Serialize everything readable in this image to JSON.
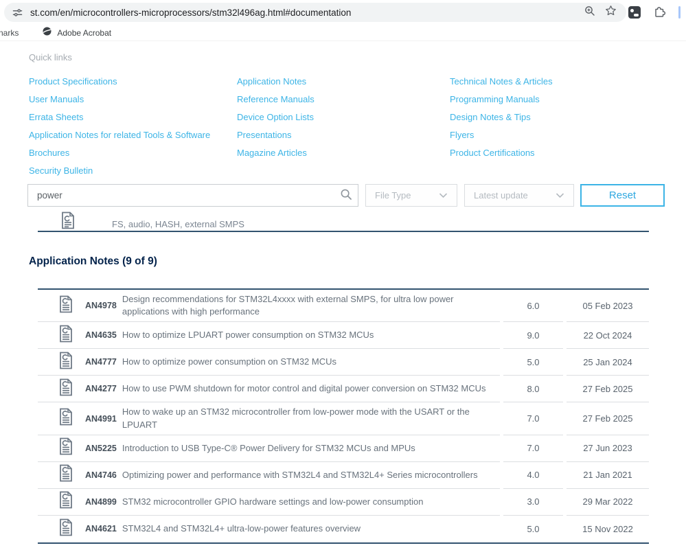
{
  "browser": {
    "url": "st.com/en/microcontrollers-microprocessors/stm32l496ag.html#documentation",
    "bookmarks_fragment": "narks",
    "bookmark_adobe_label": "Adobe Acrobat"
  },
  "quick_links": {
    "title": "Quick links",
    "columns": [
      [
        "Product Specifications",
        "User Manuals",
        "Errata Sheets",
        "Application Notes for related Tools & Software",
        "Brochures",
        "Security Bulletin"
      ],
      [
        "Application Notes",
        "Reference Manuals",
        "Device Option Lists",
        "Presentations",
        "Magazine Articles"
      ],
      [
        "Technical Notes & Articles",
        "Programming Manuals",
        "Design Notes & Tips",
        "Flyers",
        "Product Certifications"
      ]
    ]
  },
  "filters": {
    "search_value": "power",
    "file_type_label": "File Type",
    "latest_update_label": "Latest update",
    "reset_label": "Reset"
  },
  "partial_row": {
    "text": "FS, audio, HASH, external SMPS"
  },
  "section": {
    "heading": "Application Notes (9 of 9)"
  },
  "table": {
    "rows": [
      {
        "id": "AN4978",
        "title": "Design recommendations for STM32L4xxxx with external SMPS, for ultra low power applications with high performance",
        "version": "6.0",
        "date": "05 Feb 2023"
      },
      {
        "id": "AN4635",
        "title": "How to optimize LPUART power consumption on STM32 MCUs",
        "version": "9.0",
        "date": "22 Oct 2024"
      },
      {
        "id": "AN4777",
        "title": "How to optimize power consumption on STM32 MCUs",
        "version": "5.0",
        "date": "25 Jan 2024"
      },
      {
        "id": "AN4277",
        "title": "How to use PWM shutdown for motor control and digital power conversion on STM32 MCUs",
        "version": "8.0",
        "date": "27 Feb 2025"
      },
      {
        "id": "AN4991",
        "title": "How to wake up an STM32 microcontroller from low-power mode with the USART or the LPUART",
        "version": "7.0",
        "date": "27 Feb 2025"
      },
      {
        "id": "AN5225",
        "title": "Introduction to USB Type-C® Power Delivery for STM32 MCUs and MPUs",
        "version": "7.0",
        "date": "27 Jun 2023"
      },
      {
        "id": "AN4746",
        "title": "Optimizing power and performance with STM32L4 and STM32L4+ Series microcontrollers",
        "version": "4.0",
        "date": "21 Jan 2021"
      },
      {
        "id": "AN4899",
        "title": "STM32 microcontroller GPIO hardware settings and low-power consumption",
        "version": "3.0",
        "date": "29 Mar 2022"
      },
      {
        "id": "AN4621",
        "title": "STM32L4 and STM32L4+ ultra-low-power features overview",
        "version": "5.0",
        "date": "15 Nov 2022"
      }
    ]
  },
  "colors": {
    "link_blue": "#3cb4e6",
    "navy": "#03234b",
    "table_border": "#32536f",
    "text_grey": "#68727c"
  }
}
